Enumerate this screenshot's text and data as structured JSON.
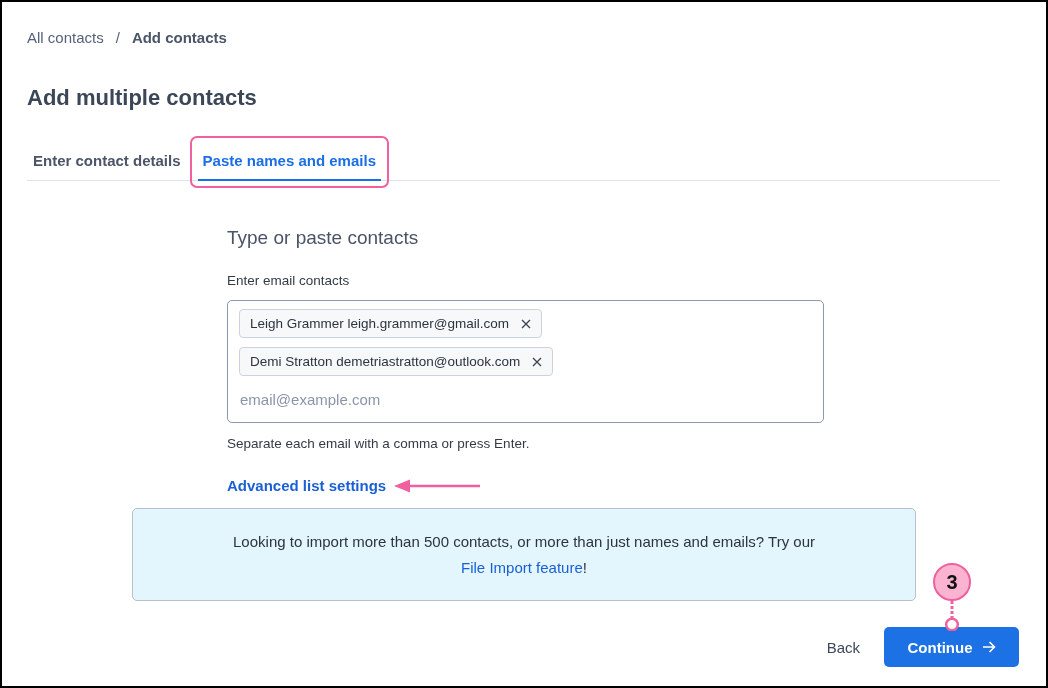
{
  "breadcrumb": {
    "items": [
      {
        "label": "All contacts",
        "current": false
      },
      {
        "label": "Add contacts",
        "current": true
      }
    ],
    "separator": "/"
  },
  "title": "Add multiple contacts",
  "tabs": [
    {
      "label": "Enter contact details",
      "selected": false,
      "highlighted": false
    },
    {
      "label": "Paste names and emails",
      "selected": true,
      "highlighted": true
    }
  ],
  "form": {
    "heading": "Type or paste contacts",
    "label": "Enter email contacts",
    "chips": [
      "Leigh Grammer leigh.grammer@gmail.com",
      "Demi Stratton demetriastratton@outlook.com"
    ],
    "placeholder": "email@example.com",
    "hint": "Separate each email with a comma or press Enter.",
    "advanced_link": "Advanced list settings",
    "pointer_arrow": true
  },
  "info": {
    "text": "Looking to import more than 500 contacts, or more than just names and emails? Try our",
    "link": "File Import feature",
    "after_link": "!"
  },
  "footer": {
    "back": "Back",
    "continue": "Continue",
    "step_callout": "3"
  }
}
